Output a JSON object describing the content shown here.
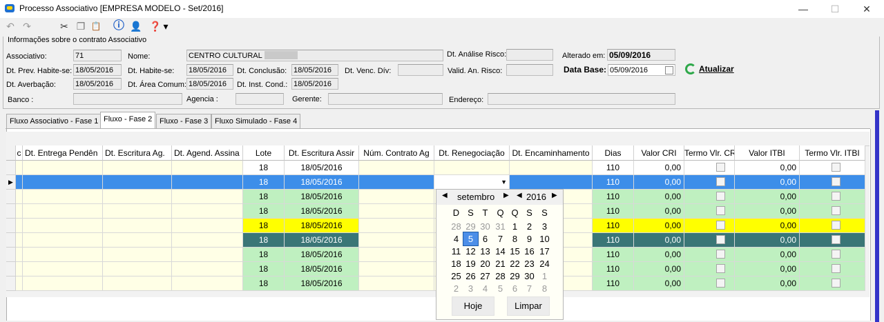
{
  "window": {
    "title": "Processo Associativo [EMPRESA MODELO - Set/2016]",
    "minimize": "—",
    "maximize": "☐",
    "close": "✕"
  },
  "toolbar": {
    "undo_glyph": "↶",
    "redo_glyph": "↷",
    "cut_glyph": "✂",
    "copy_glyph": "❐",
    "paste_glyph": "📋",
    "info_glyph": "ⓘ",
    "user_glyph": "👤",
    "help_glyph": "❓",
    "help_dropdown": "▾"
  },
  "info": {
    "legend": "Informações sobre o contrato Associativo",
    "associativo_label": "Associativo:",
    "associativo": "71",
    "nome_label": "Nome:",
    "nome": "CENTRO CULTURAL",
    "dt_analise_risco_label": "Dt. Análise Risco:",
    "dt_analise_risco": "",
    "alterado_em_label": "Alterado em:",
    "alterado_em": "05/09/2016",
    "dt_prev_habite_label": "Dt. Prev. Habite-se:",
    "dt_prev_habite": "18/05/2016",
    "dt_habite_label": "Dt. Habite-se:",
    "dt_habite": "18/05/2016",
    "dt_conclusao_label": "Dt. Conclusão:",
    "dt_conclusao": "18/05/2016",
    "dt_venc_div_label": "Dt. Venc. Dív:",
    "dt_venc_div": "",
    "valid_an_risco_label": "Valid. An. Risco:",
    "valid_an_risco": "",
    "data_base_label": "Data Base:",
    "data_base": "05/09/2016",
    "atualizar_label": "Atualizar",
    "dt_averbacao_label": "Dt. Averbação:",
    "dt_averbacao": "18/05/2016",
    "dt_area_comum_label": "Dt. Área Comum:",
    "dt_area_comum": "18/05/2016",
    "dt_inst_cond_label": "Dt. Inst. Cond.:",
    "dt_inst_cond": "18/05/2016",
    "banco_label": "Banco :",
    "banco": "",
    "agencia_label": "Agencia :",
    "agencia": "",
    "gerente_label": "Gerente:",
    "gerente": "",
    "endereco_label": "Endereço:",
    "endereco": ""
  },
  "tabs": [
    {
      "label": "Fluxo Associativo - Fase 1"
    },
    {
      "label": "Fluxo - Fase 2"
    },
    {
      "label": "Fluxo - Fase 3"
    },
    {
      "label": "Fluxo Simulado - Fase 4"
    }
  ],
  "grid": {
    "columns": [
      "c",
      "Dt. Entrega Pendên",
      "Dt. Escritura Ag.",
      "Dt. Agend. Assina",
      "Lote",
      "Dt. Escritura Assir",
      "Núm. Contrato Ag",
      "Dt. Renegociação",
      "Dt. Encaminhamento",
      "Dias",
      "Valor CRI",
      "Termo Vlr. CRI",
      "Valor ITBI",
      "Termo Vlr. ITBI"
    ],
    "current_row_marker": "▶",
    "dropdown_arrow": "▼",
    "rows": [
      {
        "lote": "18",
        "dt_escritura": "18/05/2016",
        "dias": "110",
        "valor_cri": "0,00",
        "valor_itbi": "0,00",
        "style": "white"
      },
      {
        "lote": "18",
        "dt_escritura": "18/05/2016",
        "dias": "110",
        "valor_cri": "0,00",
        "valor_itbi": "0,00",
        "style": "selected"
      },
      {
        "lote": "18",
        "dt_escritura": "18/05/2016",
        "dias": "110",
        "valor_cri": "0,00",
        "valor_itbi": "0,00",
        "style": "green"
      },
      {
        "lote": "18",
        "dt_escritura": "18/05/2016",
        "dias": "110",
        "valor_cri": "0,00",
        "valor_itbi": "0,00",
        "style": "green"
      },
      {
        "lote": "18",
        "dt_escritura": "18/05/2016",
        "dias": "110",
        "valor_cri": "0,00",
        "valor_itbi": "0,00",
        "style": "yellow"
      },
      {
        "lote": "18",
        "dt_escritura": "18/05/2016",
        "dias": "110",
        "valor_cri": "0,00",
        "valor_itbi": "0,00",
        "style": "teal"
      },
      {
        "lote": "18",
        "dt_escritura": "18/05/2016",
        "dias": "110",
        "valor_cri": "0,00",
        "valor_itbi": "0,00",
        "style": "green"
      },
      {
        "lote": "18",
        "dt_escritura": "18/05/2016",
        "dias": "110",
        "valor_cri": "0,00",
        "valor_itbi": "0,00",
        "style": "green"
      },
      {
        "lote": "18",
        "dt_escritura": "18/05/2016",
        "dias": "110",
        "valor_cri": "0,00",
        "valor_itbi": "0,00",
        "style": "green"
      }
    ]
  },
  "calendar": {
    "month": "setembro",
    "year": "2016",
    "prev": "◀",
    "next": "▶",
    "weekdays": [
      "D",
      "S",
      "T",
      "Q",
      "Q",
      "S",
      "S"
    ],
    "weeks": [
      [
        "28",
        "29",
        "30",
        "31",
        "1",
        "2",
        "3"
      ],
      [
        "4",
        "5",
        "6",
        "7",
        "8",
        "9",
        "10"
      ],
      [
        "11",
        "12",
        "13",
        "14",
        "15",
        "16",
        "17"
      ],
      [
        "18",
        "19",
        "20",
        "21",
        "22",
        "23",
        "24"
      ],
      [
        "25",
        "26",
        "27",
        "28",
        "29",
        "30",
        "1"
      ],
      [
        "2",
        "3",
        "4",
        "5",
        "6",
        "7",
        "8"
      ]
    ],
    "selected": "5",
    "today_label": "Hoje",
    "clear_label": "Limpar"
  },
  "colors": {
    "white": "#ffffff",
    "selected": "#3d8ee9",
    "green": "#bff0c0",
    "yellow": "#ffff00",
    "teal": "#3a7676",
    "cream": "#ffffe6"
  }
}
